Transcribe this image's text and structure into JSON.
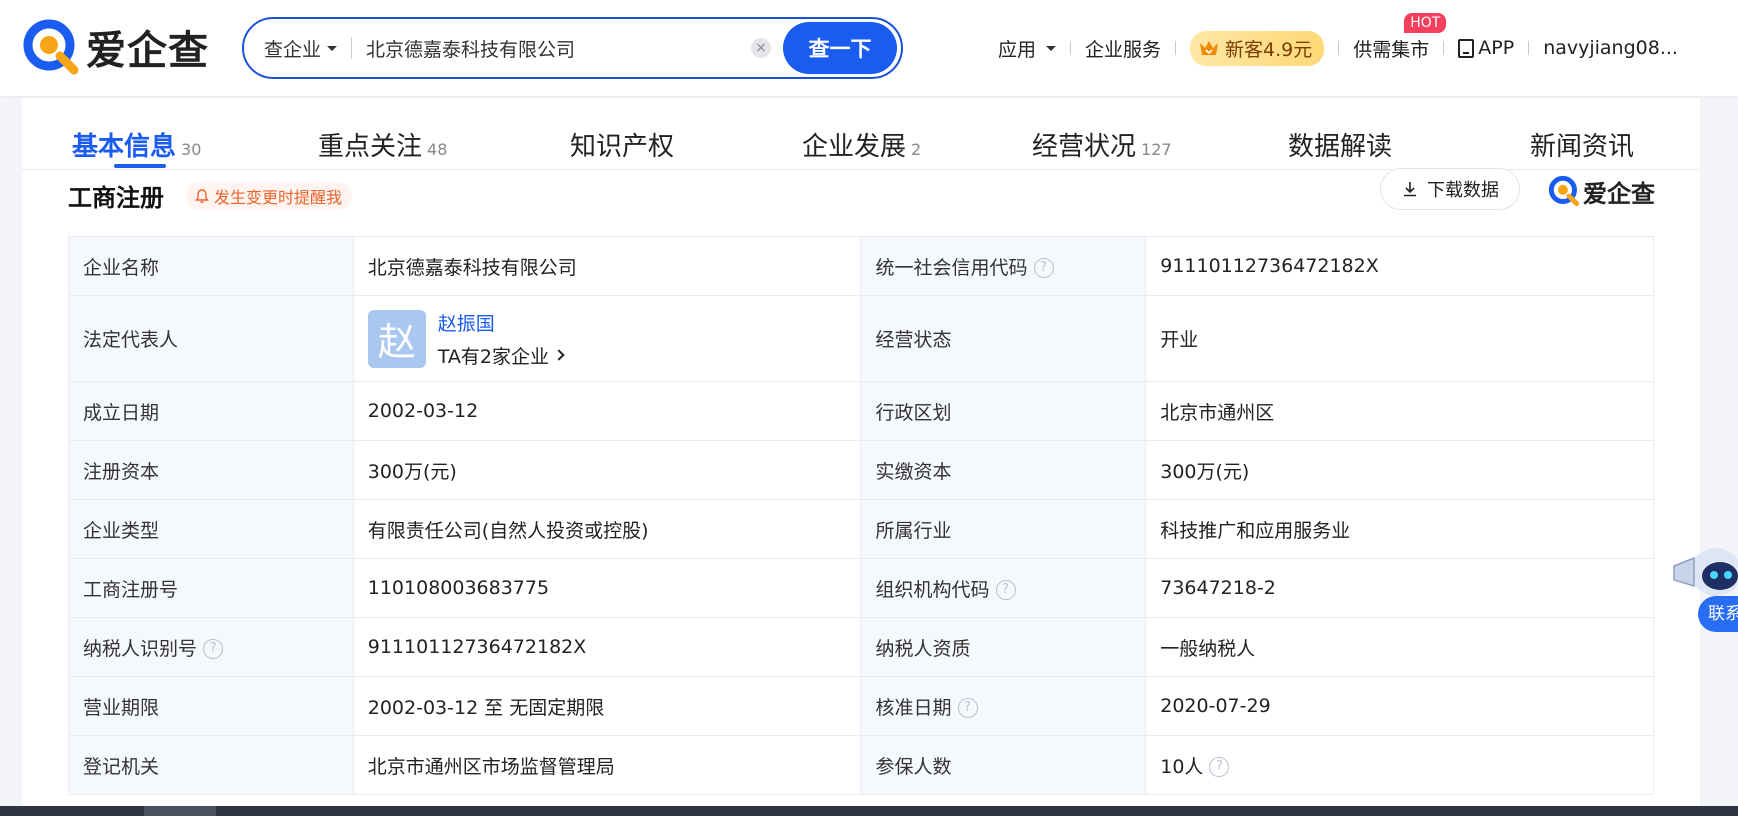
{
  "header": {
    "logo_text": "爱企查",
    "search": {
      "type_label": "查企业",
      "query": "北京德嘉泰科技有限公司",
      "button_label": "查一下"
    },
    "nav": {
      "apps": "应用",
      "enterprise_services": "企业服务",
      "promo": "新客4.9元",
      "market": "供需集市",
      "hot_badge": "HOT",
      "app": "APP",
      "user": "navyjiang08..."
    }
  },
  "tabs": [
    {
      "label": "基本信息",
      "count": "30"
    },
    {
      "label": "重点关注",
      "count": "48"
    },
    {
      "label": "知识产权",
      "count": ""
    },
    {
      "label": "企业发展",
      "count": "2"
    },
    {
      "label": "经营状况",
      "count": "127"
    },
    {
      "label": "数据解读",
      "count": ""
    },
    {
      "label": "新闻资讯",
      "count": ""
    }
  ],
  "section": {
    "title": "工商注册",
    "remind_label": "发生变更时提醒我",
    "download_label": "下载数据",
    "logo_text": "爱企查"
  },
  "rows": [
    {
      "k1": "企业名称",
      "v1": "北京德嘉泰科技有限公司",
      "k2": "统一社会信用代码",
      "v2": "91110112736472182X"
    },
    {
      "k1": "法定代表人",
      "rep_avatar": "赵",
      "rep_name": "赵振国",
      "rep_sub": "TA有2家企业",
      "k2": "经营状态",
      "v2": "开业"
    },
    {
      "k1": "成立日期",
      "v1": "2002-03-12",
      "k2": "行政区划",
      "v2": "北京市通州区"
    },
    {
      "k1": "注册资本",
      "v1": "300万(元)",
      "k2": "实缴资本",
      "v2": "300万(元)"
    },
    {
      "k1": "企业类型",
      "v1": "有限责任公司(自然人投资或控股)",
      "k2": "所属行业",
      "v2": "科技推广和应用服务业"
    },
    {
      "k1": "工商注册号",
      "v1": "110108003683775",
      "k2": "组织机构代码",
      "v2": "73647218-2"
    },
    {
      "k1": "纳税人识别号",
      "v1": "91110112736472182X",
      "k2": "纳税人资质",
      "v2": "一般纳税人"
    },
    {
      "k1": "营业期限",
      "v1": "2002-03-12 至 无固定期限",
      "k2": "核准日期",
      "v2": "2020-07-29"
    },
    {
      "k1": "登记机关",
      "v1": "北京市通州区市场监督管理局",
      "k2": "参保人数",
      "v2": "10人"
    }
  ],
  "help_glyph": "?",
  "clear_glyph": "×",
  "contact_label": "联系",
  "colors": {
    "brand": "#1a5cf0",
    "orange": "#f7a416",
    "remind": "#e8642c",
    "hot": "#f4405c"
  }
}
